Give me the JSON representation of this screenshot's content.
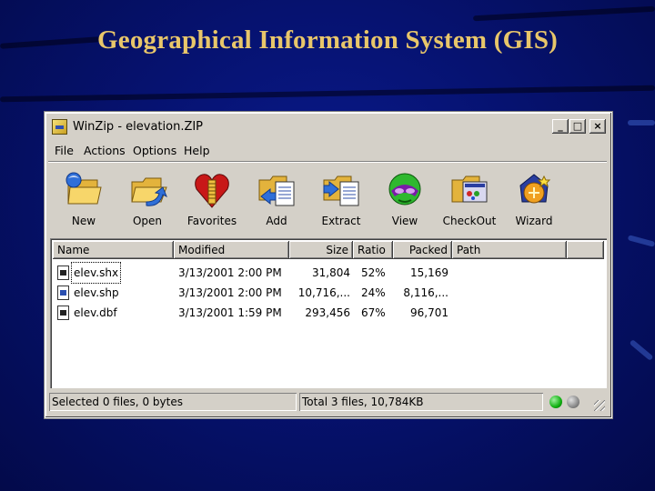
{
  "slide": {
    "title": "Geographical Information System (GIS)"
  },
  "window": {
    "title": "WinZip - elevation.ZIP",
    "icon": "winzip-app-icon",
    "controls": [
      "_",
      "□",
      "×"
    ]
  },
  "menu": [
    "File",
    "Actions",
    "Options",
    "Help"
  ],
  "toolbar": [
    {
      "label": "New",
      "icon": "new-archive-icon"
    },
    {
      "label": "Open",
      "icon": "open-archive-icon"
    },
    {
      "label": "Favorites",
      "icon": "favorites-icon"
    },
    {
      "label": "Add",
      "icon": "add-icon"
    },
    {
      "label": "Extract",
      "icon": "extract-icon"
    },
    {
      "label": "View",
      "icon": "view-icon"
    },
    {
      "label": "CheckOut",
      "icon": "checkout-icon"
    },
    {
      "label": "Wizard",
      "icon": "wizard-icon"
    }
  ],
  "columns": [
    "Name",
    "Modified",
    "Size",
    "Ratio",
    "Packed",
    "Path"
  ],
  "files": [
    {
      "name": "elev.shx",
      "modified": "3/13/2001 2:00 PM",
      "size": "31,804",
      "ratio": "52%",
      "packed": "15,169",
      "path": ""
    },
    {
      "name": "elev.shp",
      "modified": "3/13/2001 2:00 PM",
      "size": "10,716,...",
      "ratio": "24%",
      "packed": "8,116,...",
      "path": ""
    },
    {
      "name": "elev.dbf",
      "modified": "3/13/2001 1:59 PM",
      "size": "293,456",
      "ratio": "67%",
      "packed": "96,701",
      "path": ""
    }
  ],
  "status": {
    "selected": "Selected 0 files, 0 bytes",
    "total": "Total 3 files, 10,784KB"
  },
  "colors": {
    "title": "#e8c66a",
    "background": "#061270",
    "led_green": "#10b010",
    "led_gray": "#8a8a8a"
  }
}
